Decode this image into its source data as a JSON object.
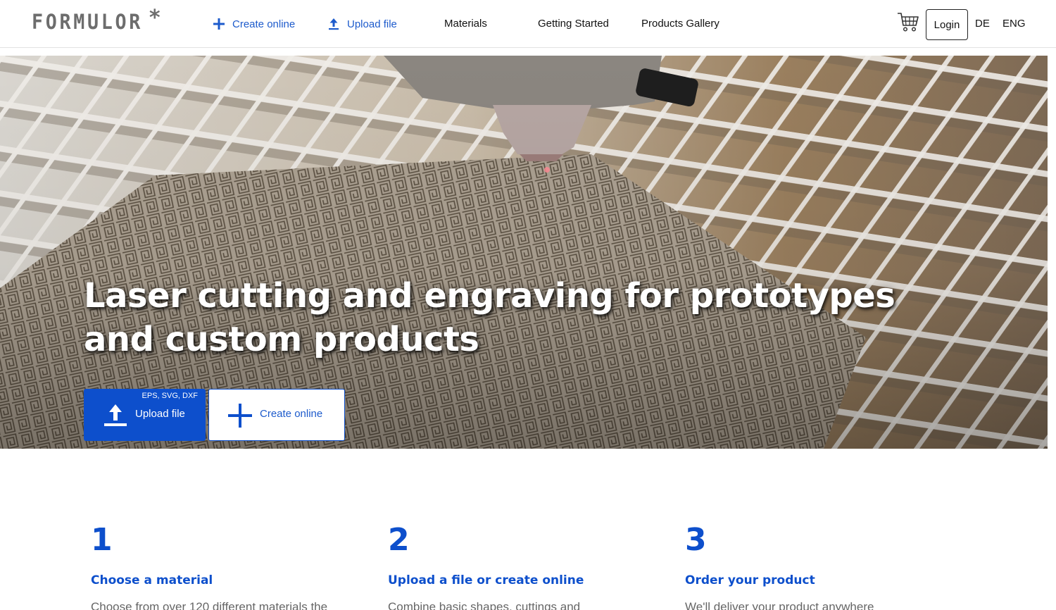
{
  "header": {
    "logo": "FORMULOR",
    "logo_mark": "*",
    "actions": [
      {
        "label": "Create online",
        "icon": "plus-icon"
      },
      {
        "label": "Upload file",
        "icon": "upload-icon"
      }
    ],
    "nav": [
      "Materials",
      "Getting Started",
      "Products Gallery"
    ],
    "cart_icon": "cart-icon",
    "login_label": "Login",
    "languages": [
      "DE",
      "ENG"
    ]
  },
  "hero": {
    "title_line1": "Laser cutting and engraving for prototypes",
    "title_line2": "and custom products",
    "upload_formats": "EPS, SVG, DXF",
    "upload_label": "Upload file",
    "create_label": "Create online"
  },
  "steps": [
    {
      "number": "1",
      "title": "Choose a material",
      "description": "Choose from over 120 different materials the"
    },
    {
      "number": "2",
      "title": "Upload a file or create online",
      "description": "Combine basic shapes, cuttings and"
    },
    {
      "number": "3",
      "title": "Order your product",
      "description": "We'll deliver your product anywhere"
    }
  ],
  "colors": {
    "accent": "#0d4fcc",
    "link": "#1d5bcc",
    "logo": "#6d6d6d",
    "muted_text": "#666666"
  }
}
